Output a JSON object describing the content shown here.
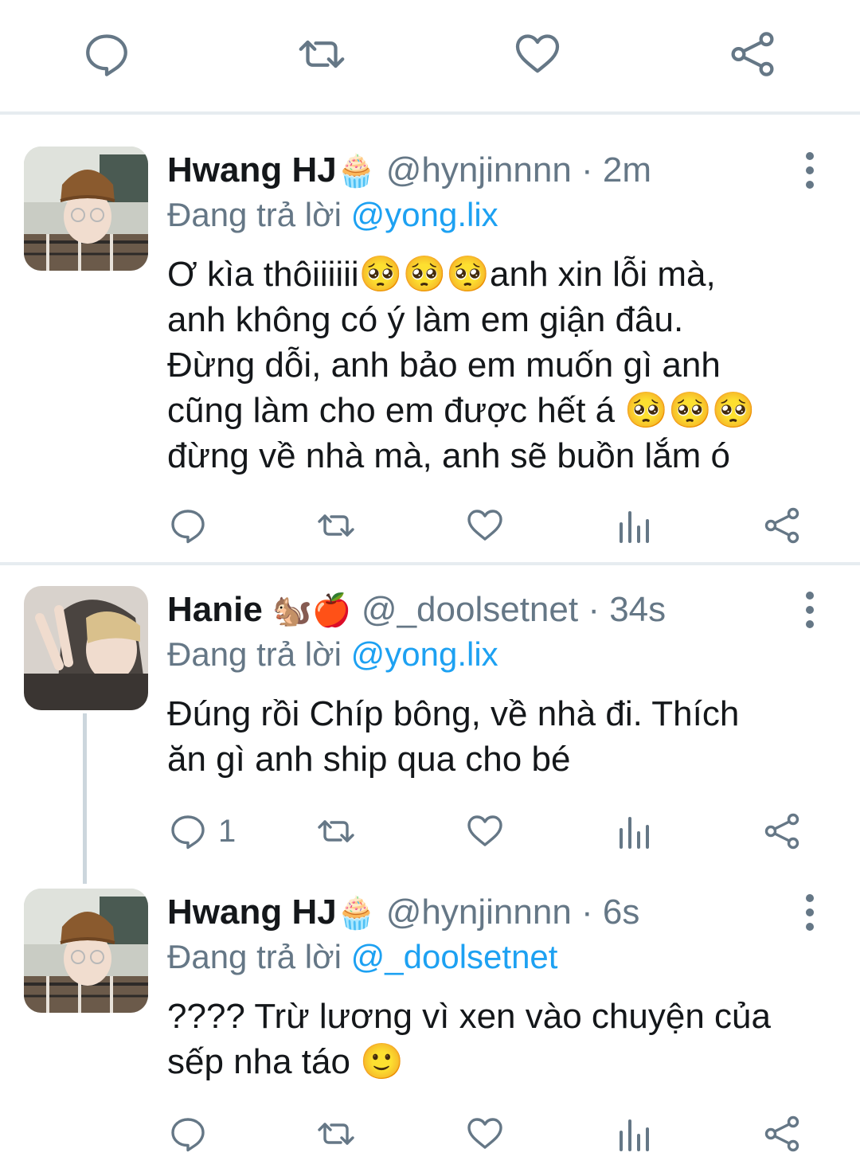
{
  "colors": {
    "accent": "#1da1f2",
    "secondary_text": "#657786",
    "icon": "#657786"
  },
  "top_actions": [
    "reply-icon",
    "retweet-icon",
    "like-icon",
    "share-icon"
  ],
  "tweets": [
    {
      "name": "Hwang HJ",
      "name_emoji": "🧁",
      "handle": "@hynjinnnn",
      "time": "· 2m",
      "replying_prefix": "Đang trả lời",
      "replying_to": "@yong.lix",
      "lines": [
        "Ơ kìa thôiiiiii🥺🥺🥺anh xin lỗi mà,",
        "anh không có ý làm em giận đâu.",
        "Đừng dỗi, anh bảo em muốn gì anh",
        "cũng làm cho em được hết á 🥺🥺🥺",
        "đừng về nhà mà, anh sẽ buồn lắm ó"
      ],
      "reply_count": ""
    },
    {
      "name": "Hanie",
      "name_emoji": "🐿️🍎",
      "handle": "@_doolsetnet",
      "time": "· 34s",
      "replying_prefix": "Đang trả lời",
      "replying_to": "@yong.lix",
      "lines": [
        "Đúng rồi Chíp bông, về nhà đi. Thích",
        "ăn gì anh ship qua cho bé"
      ],
      "reply_count": "1"
    },
    {
      "name": "Hwang HJ",
      "name_emoji": "🧁",
      "handle": "@hynjinnnn",
      "time": "· 6s",
      "replying_prefix": "Đang trả lời",
      "replying_to": "@_doolsetnet",
      "lines": [
        "???? Trừ lương vì xen vào chuyện của",
        "sếp nha táo 🙂"
      ],
      "reply_count": ""
    }
  ]
}
